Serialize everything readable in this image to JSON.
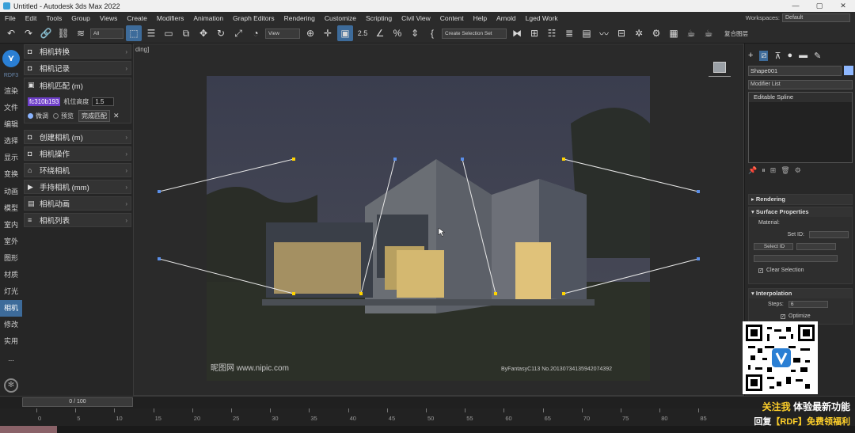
{
  "window": {
    "title": "Untitled - Autodesk 3ds Max 2022"
  },
  "menu": [
    "File",
    "Edit",
    "Tools",
    "Group",
    "Views",
    "Create",
    "Modifiers",
    "Animation",
    "Graph Editors",
    "Rendering",
    "Customize",
    "Scripting",
    "Civil View",
    "Content",
    "Help",
    "Arnold",
    "Lged Work"
  ],
  "workspaces": {
    "label": "Workspaces:",
    "value": "Default"
  },
  "toolbar": {
    "filter_select": "All",
    "view_select": "View",
    "selection_set": "Create Selection Set",
    "snap_value": "2.5",
    "right_text": "复合图层"
  },
  "left_sidebar": {
    "logo_label": "RDF3",
    "items": [
      "渲染",
      "文件",
      "编辑",
      "选择",
      "显示",
      "变换",
      "动画",
      "模型",
      "室内",
      "室外",
      "图形",
      "材质",
      "灯光",
      "相机",
      "修改",
      "实用",
      "..."
    ],
    "selected_index": 13
  },
  "plugin_panel": {
    "rows": [
      {
        "label": "相机转换",
        "icon": "camera-icon"
      },
      {
        "label": "相机记录",
        "icon": "camera-icon"
      },
      {
        "label": "相机匹配 (m)",
        "icon": "frame-icon"
      },
      {
        "label": "创建相机 (m)",
        "icon": "camera-icon"
      },
      {
        "label": "相机操作",
        "icon": "camera-icon"
      },
      {
        "label": "环绕相机",
        "icon": "orbit-icon"
      },
      {
        "label": "手持相机 (mm)",
        "icon": "video-icon"
      },
      {
        "label": "相机动画",
        "icon": "film-icon"
      },
      {
        "label": "相机列表",
        "icon": "list-icon"
      }
    ],
    "match": {
      "camera_tag": "fc310b193",
      "height_label": "机位高度",
      "height_value": "1.5",
      "radio_fine": "微调",
      "radio_preview": "预览",
      "finish_button": "完成匹配"
    }
  },
  "viewport": {
    "label": "ding]",
    "watermark_left": "昵图网 www.nipic.com",
    "watermark_right": "ByFantasyC113 No.20130734135942074392"
  },
  "command_panel": {
    "object_name": "Shape001",
    "modifier_list": "Modifier List",
    "stack_item": "Editable Spline",
    "rendering": "Rendering",
    "surface": {
      "header": "Surface Properties",
      "material": "Material:",
      "set_id": "Set ID:",
      "select_id": "Select ID",
      "clear_selection": "Clear Selection"
    },
    "interpolation": {
      "header": "Interpolation",
      "steps_label": "Steps:",
      "steps_value": "6",
      "optimize": "Optimize"
    },
    "accent": "#8fb8ff"
  },
  "timeline": {
    "frame": "0 / 100",
    "ticks": [
      "0",
      "5",
      "10",
      "15",
      "20",
      "25",
      "30",
      "35",
      "40",
      "45",
      "50",
      "55",
      "60",
      "65",
      "70",
      "75",
      "80",
      "85"
    ]
  },
  "promo": {
    "line1_yellow": "关注我",
    "line1_white": " 体验最新功能",
    "line2_white_a": "回复",
    "line2_yellow_a": "【RDF】",
    "line2_yellow_b": "免费领福利"
  }
}
